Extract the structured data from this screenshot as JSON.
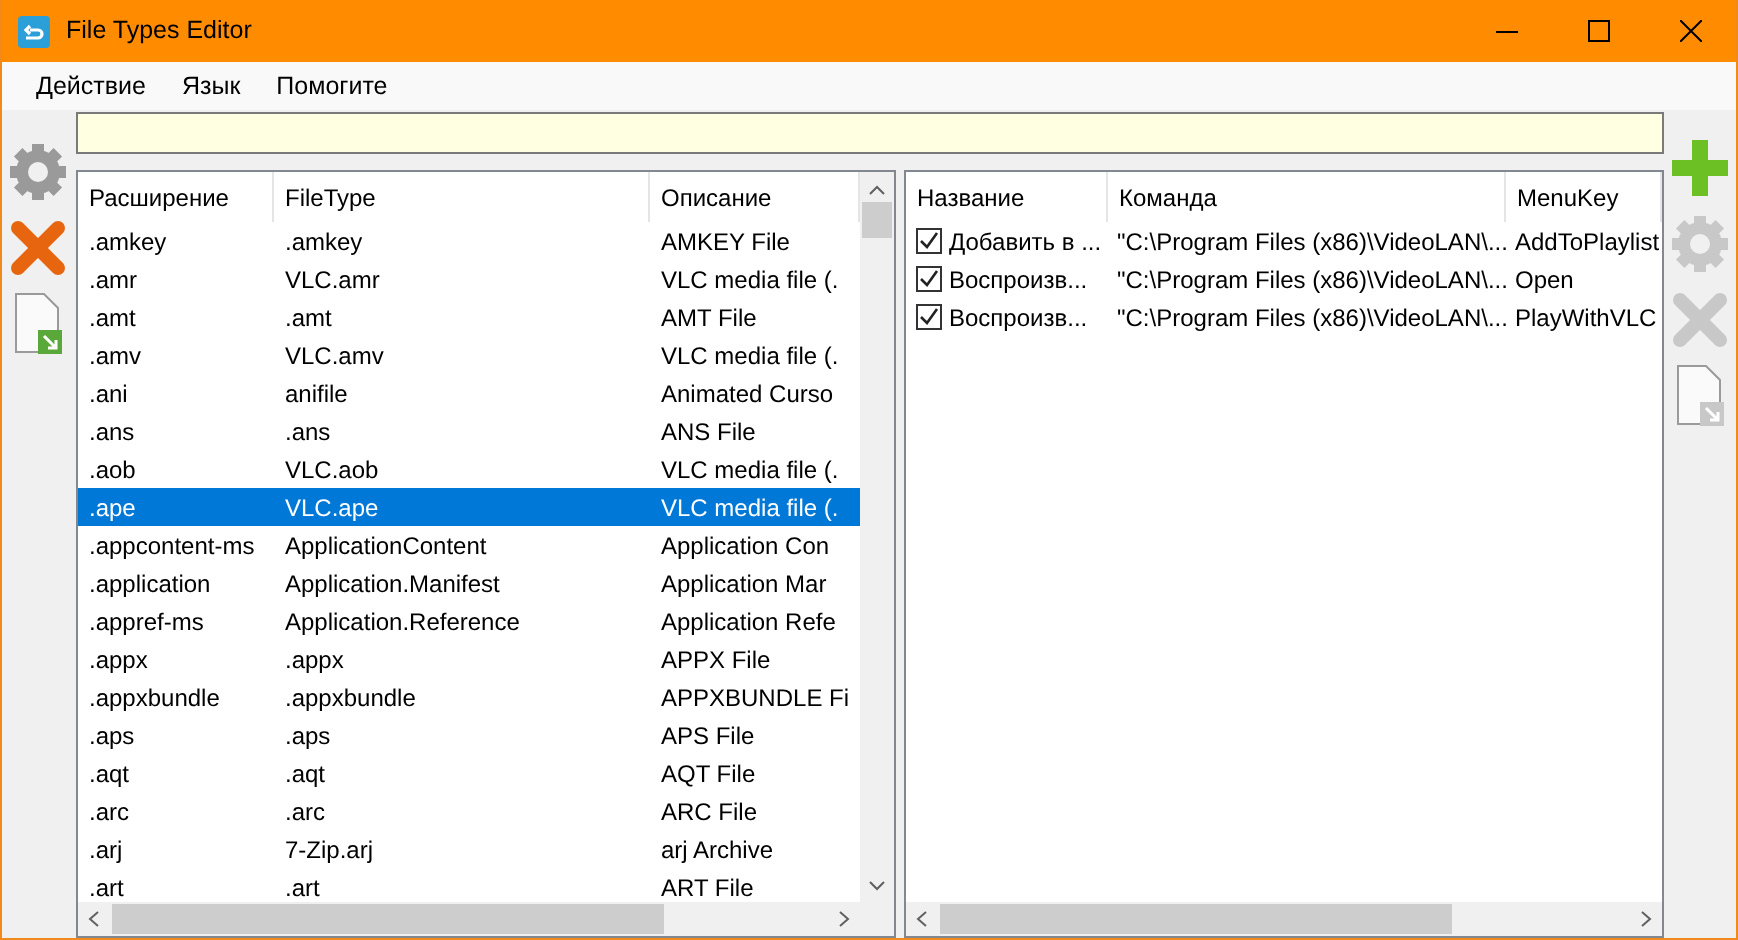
{
  "window": {
    "title": "File Types Editor"
  },
  "menu": [
    {
      "label": "Действие"
    },
    {
      "label": "Язык"
    },
    {
      "label": "Помогите"
    }
  ],
  "left_toolbar": [
    {
      "kind": "settings",
      "disabled": false
    },
    {
      "kind": "delete",
      "disabled": false
    },
    {
      "kind": "export",
      "disabled": false
    }
  ],
  "file_types": {
    "columns": [
      "Расширение",
      "FileType",
      "Описание"
    ],
    "rows": [
      {
        "cells": [
          ".amkey",
          ".amkey",
          "AMKEY File"
        ],
        "selected": false
      },
      {
        "cells": [
          ".amr",
          "VLC.amr",
          "VLC media file (."
        ],
        "selected": false
      },
      {
        "cells": [
          ".amt",
          ".amt",
          "AMT File"
        ],
        "selected": false
      },
      {
        "cells": [
          ".amv",
          "VLC.amv",
          "VLC media file (."
        ],
        "selected": false
      },
      {
        "cells": [
          ".ani",
          "anifile",
          "Animated Curso"
        ],
        "selected": false
      },
      {
        "cells": [
          ".ans",
          ".ans",
          "ANS File"
        ],
        "selected": false
      },
      {
        "cells": [
          ".aob",
          "VLC.aob",
          "VLC media file (."
        ],
        "selected": false
      },
      {
        "cells": [
          ".ape",
          "VLC.ape",
          "VLC media file (."
        ],
        "selected": true
      },
      {
        "cells": [
          ".appcontent-ms",
          "ApplicationContent",
          "Application Con"
        ],
        "selected": false
      },
      {
        "cells": [
          ".application",
          "Application.Manifest",
          "Application Mar"
        ],
        "selected": false
      },
      {
        "cells": [
          ".appref-ms",
          "Application.Reference",
          "Application Refe"
        ],
        "selected": false
      },
      {
        "cells": [
          ".appx",
          ".appx",
          "APPX File"
        ],
        "selected": false
      },
      {
        "cells": [
          ".appxbundle",
          ".appxbundle",
          "APPXBUNDLE Fi"
        ],
        "selected": false
      },
      {
        "cells": [
          ".aps",
          ".aps",
          "APS File"
        ],
        "selected": false
      },
      {
        "cells": [
          ".aqt",
          ".aqt",
          "AQT File"
        ],
        "selected": false
      },
      {
        "cells": [
          ".arc",
          ".arc",
          "ARC File"
        ],
        "selected": false
      },
      {
        "cells": [
          ".arj",
          "7-Zip.arj",
          "arj Archive"
        ],
        "selected": false
      },
      {
        "cells": [
          ".art",
          ".art",
          "ART File"
        ],
        "selected": false
      }
    ]
  },
  "commands": {
    "columns": [
      "Название",
      "Команда",
      "MenuKey"
    ],
    "rows": [
      {
        "checked": true,
        "cells": [
          "Добавить в ...",
          "\"C:\\Program Files (x86)\\VideoLAN\\...",
          "AddToPlaylist"
        ]
      },
      {
        "checked": true,
        "cells": [
          "Воспроизв...",
          "\"C:\\Program Files (x86)\\VideoLAN\\...",
          "Open"
        ]
      },
      {
        "checked": true,
        "cells": [
          "Воспроизв...",
          "\"C:\\Program Files (x86)\\VideoLAN\\...",
          "PlayWithVLC"
        ]
      }
    ]
  },
  "right_toolbar": [
    {
      "kind": "add",
      "disabled": false
    },
    {
      "kind": "settings",
      "disabled": true
    },
    {
      "kind": "delete",
      "disabled": true
    },
    {
      "kind": "export",
      "disabled": true
    }
  ]
}
